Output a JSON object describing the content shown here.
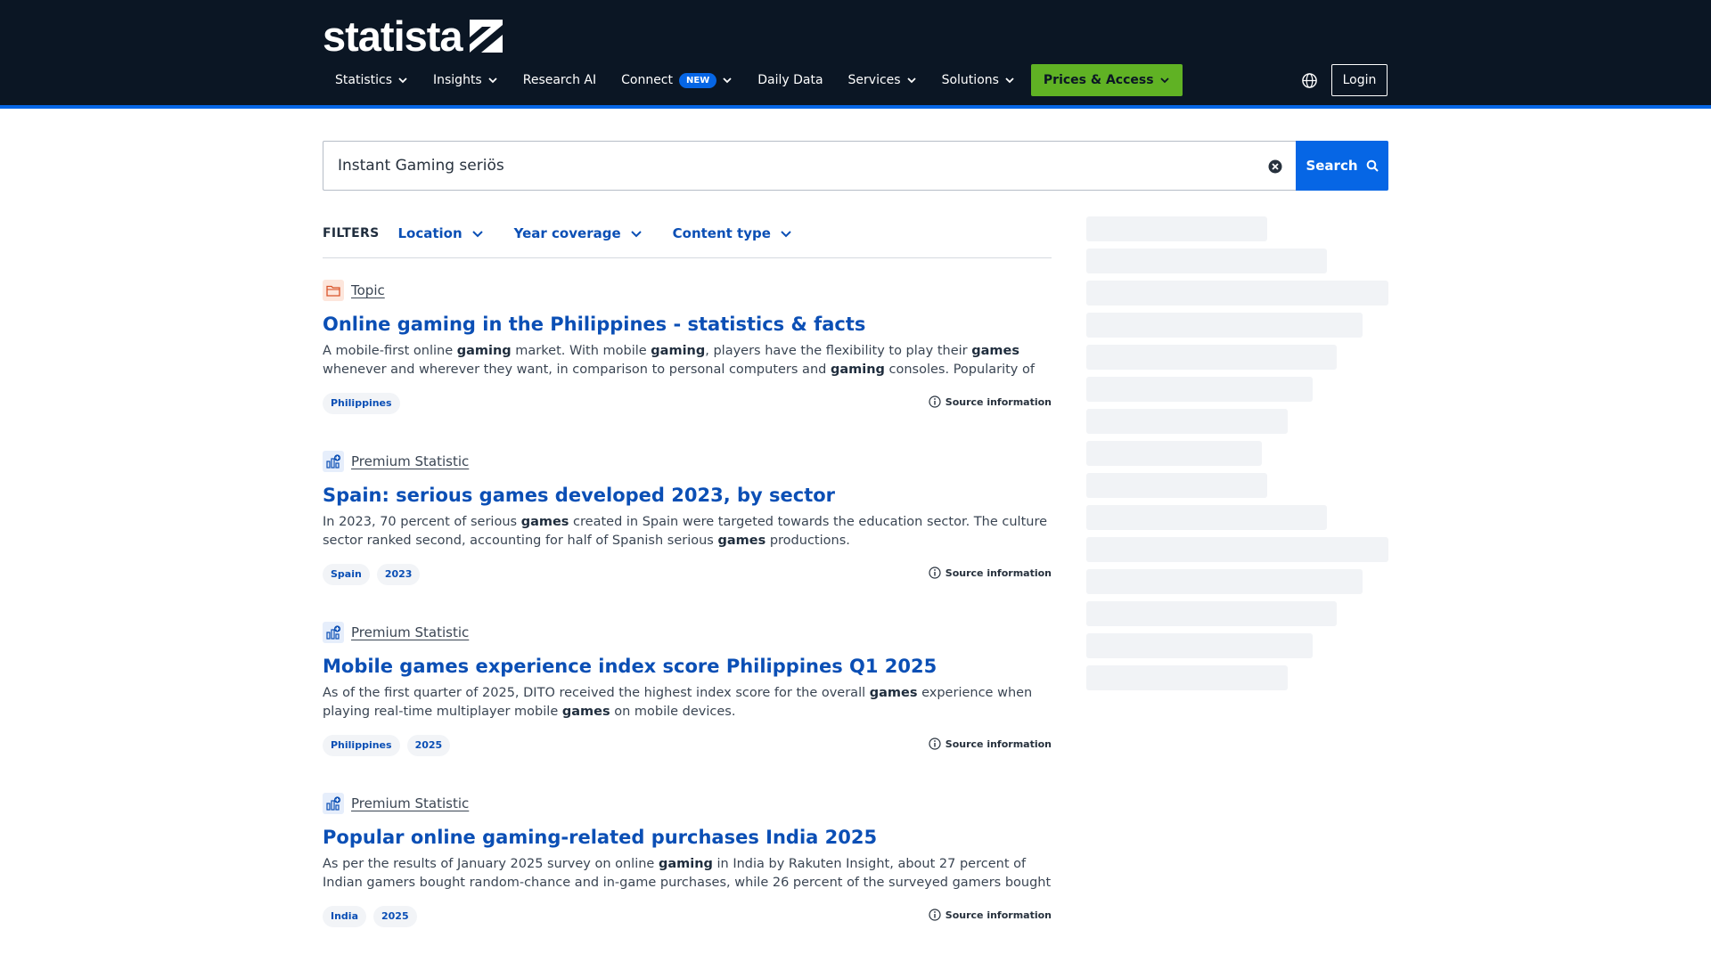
{
  "brand": {
    "name": "statista"
  },
  "nav": {
    "items": [
      {
        "label": "Statistics",
        "dropdown": true
      },
      {
        "label": "Insights",
        "dropdown": true
      },
      {
        "label": "Research AI",
        "dropdown": false
      },
      {
        "label": "Connect",
        "dropdown": true,
        "badge": "NEW"
      },
      {
        "label": "Daily Data",
        "dropdown": false
      },
      {
        "label": "Services",
        "dropdown": true
      },
      {
        "label": "Solutions",
        "dropdown": true
      }
    ],
    "cta": "Prices & Access",
    "login": "Login"
  },
  "search": {
    "value": "Instant Gaming seriös",
    "button_label": "Search"
  },
  "filters": {
    "label": "FILTERS",
    "items": [
      "Location",
      "Year coverage",
      "Content type"
    ]
  },
  "results": [
    {
      "type": "Topic",
      "icon": "folder-icon",
      "title": "Online gaming in the Philippines - statistics & facts",
      "description_html": "A mobile-first online <b>gaming</b> market. With mobile <b>gaming</b>, players have the flexibility to play their <b>games</b> whenever and wherever they want, in comparison to personal computers and <b>gaming</b> consoles. Popularity of role-playing <b>games</b>. The…",
      "tags": [
        "Philippines"
      ],
      "source_label": "Source information"
    },
    {
      "type": "Premium Statistic",
      "icon": "premium-statistic-icon",
      "title": "Spain: serious games developed 2023, by sector",
      "description_html": "In 2023, 70 percent of serious <b>games</b> created in Spain were targeted towards the education sector. The culture sector ranked second, accounting for half of Spanish serious <b>games</b> productions.",
      "tags": [
        "Spain",
        "2023"
      ],
      "source_label": "Source information"
    },
    {
      "type": "Premium Statistic",
      "icon": "premium-statistic-icon",
      "title": "Mobile games experience index score Philippines Q1 2025",
      "description_html": "As of the first quarter of 2025, DITO received the highest index score for the overall <b>games</b> experience when playing real-time multiplayer mobile <b>games</b> on mobile devices.",
      "tags": [
        "Philippines",
        "2025"
      ],
      "source_label": "Source information"
    },
    {
      "type": "Premium Statistic",
      "icon": "premium-statistic-icon",
      "title": "Popular online gaming-related purchases India 2025",
      "description_html": "As per the results of January 2025 survey on online <b>gaming</b> in India by Rakuten Insight, about 27 percent of Indian gamers bought random-chance and in-game purchases, while 26 percent of the surveyed gamers bought in-game currencies.",
      "tags": [
        "India",
        "2025"
      ],
      "source_label": "Source information"
    }
  ],
  "colors": {
    "header_bg": "#0b1624",
    "accent_blue": "#0666e5",
    "cta_green": "#60b224",
    "link_blue": "#0b4fb5"
  }
}
